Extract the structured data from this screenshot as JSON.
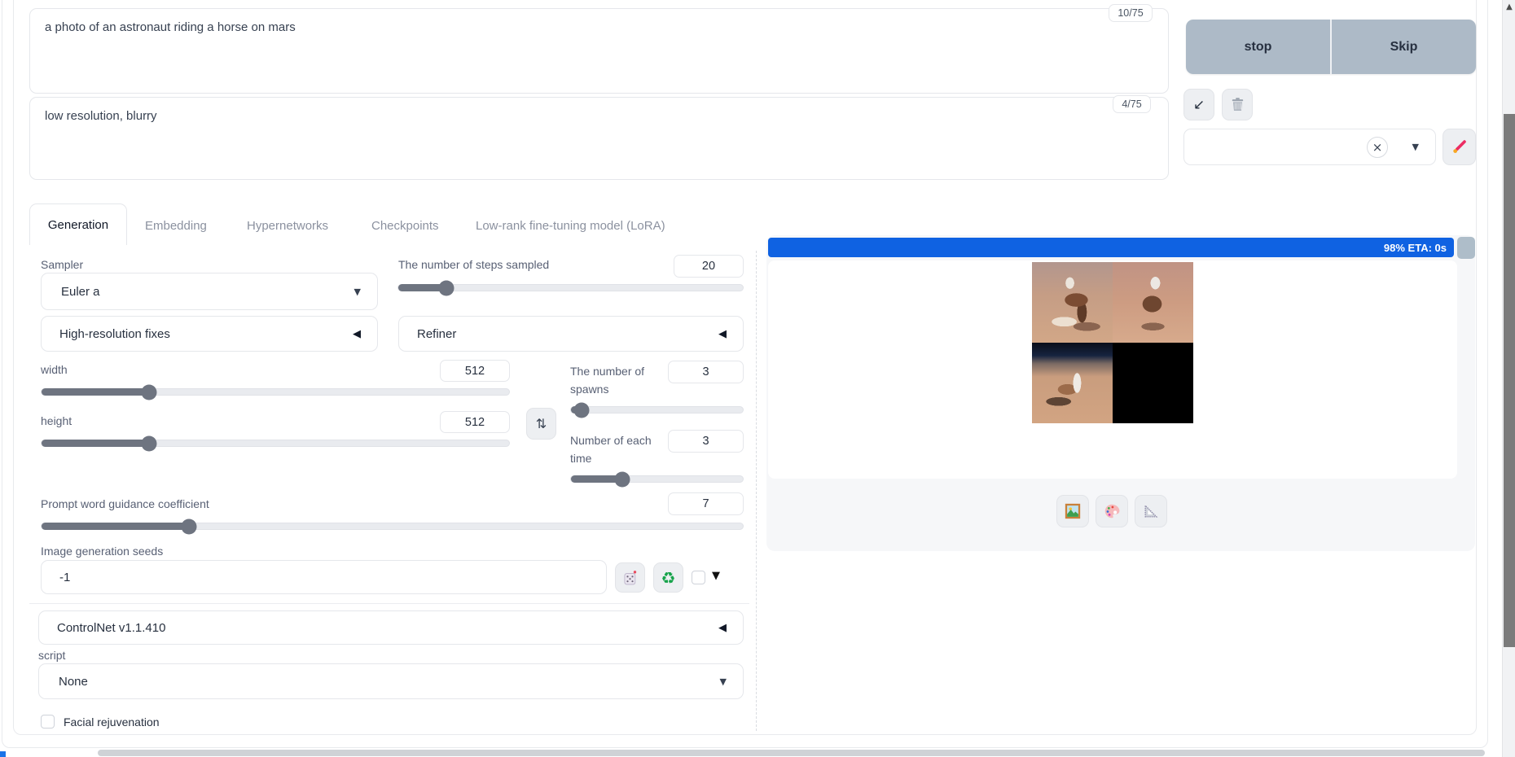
{
  "prompts": {
    "positive": {
      "value": "a photo of an astronaut riding a horse on mars",
      "counter": "10/75"
    },
    "negative": {
      "value": "low resolution, blurry",
      "counter": "4/75"
    }
  },
  "toolbar": {
    "stop_label": "stop",
    "skip_label": "Skip"
  },
  "tabs": [
    {
      "label": "Generation",
      "active": true
    },
    {
      "label": "Embedding",
      "active": false
    },
    {
      "label": "Hypernetworks",
      "active": false
    },
    {
      "label": "Checkpoints",
      "active": false
    },
    {
      "label": "Low-rank fine-tuning model (LoRA)",
      "active": false
    }
  ],
  "generation": {
    "sampler": {
      "label": "Sampler",
      "value": "Euler a"
    },
    "steps": {
      "label": "The number of steps sampled",
      "value": "20"
    },
    "hires": {
      "label": "High-resolution fixes"
    },
    "refiner": {
      "label": "Refiner"
    },
    "width": {
      "label": "width",
      "value": "512"
    },
    "height": {
      "label": "height",
      "value": "512"
    },
    "batch_count": {
      "label": "The number of spawns",
      "value": "3"
    },
    "batch_size": {
      "label": "Number of each time",
      "value": "3"
    },
    "cfg": {
      "label": "Prompt word guidance coefficient",
      "value": "7"
    },
    "seed": {
      "label": "Image generation seeds",
      "value": "-1"
    },
    "controlnet": {
      "label": "ControlNet v1.1.410"
    },
    "script": {
      "label": "script",
      "value": "None"
    },
    "face_restore": {
      "label": "Facial rejuvenation",
      "checked": false
    }
  },
  "output": {
    "progress_text": "98% ETA: 0s",
    "progress_percent": 98
  },
  "icons": {
    "southwest_arrow": "↙",
    "swap": "⇅",
    "accordion_collapsed": "◀",
    "dropdown_caret": "▼",
    "clear_x": "×",
    "seed_extra_caret": "▼",
    "scroll_up": "▲",
    "recycle": "♻"
  },
  "colors": {
    "progress_blue": "#0f62e2",
    "action_button_gray_blue": "#adbac7",
    "slider_fill_gray": "#6e7480"
  }
}
